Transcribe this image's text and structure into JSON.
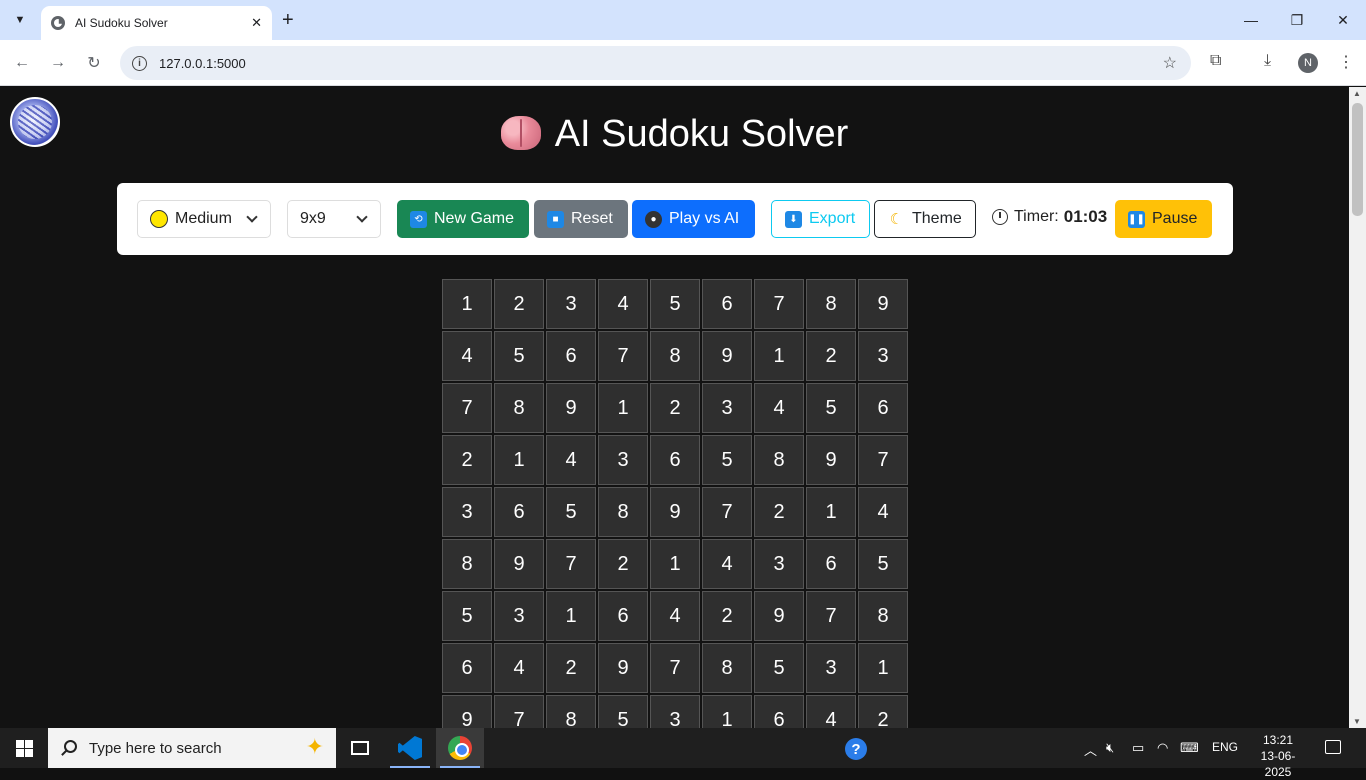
{
  "browser": {
    "tab_title": "AI Sudoku Solver",
    "url": "127.0.0.1:5000",
    "profile_initial": "N"
  },
  "page": {
    "title": "AI Sudoku Solver"
  },
  "controls": {
    "difficulty": "Medium",
    "grid_size": "9x9",
    "new_game_label": "New Game",
    "reset_label": "Reset",
    "play_ai_label": "Play vs AI",
    "export_label": "Export",
    "theme_label": "Theme",
    "timer_label": "Timer:",
    "timer_value": "01:03",
    "pause_label": "Pause"
  },
  "colors": {
    "new_game": "#198754",
    "reset": "#6c757d",
    "play_ai": "#0d6efd",
    "export": "#0dcaf0",
    "pause": "#ffc107",
    "page_bg": "#121212",
    "cell_bg": "#2f2f2f"
  },
  "board": [
    [
      1,
      2,
      3,
      4,
      5,
      6,
      7,
      8,
      9
    ],
    [
      4,
      5,
      6,
      7,
      8,
      9,
      1,
      2,
      3
    ],
    [
      7,
      8,
      9,
      1,
      2,
      3,
      4,
      5,
      6
    ],
    [
      2,
      1,
      4,
      3,
      6,
      5,
      8,
      9,
      7
    ],
    [
      3,
      6,
      5,
      8,
      9,
      7,
      2,
      1,
      4
    ],
    [
      8,
      9,
      7,
      2,
      1,
      4,
      3,
      6,
      5
    ],
    [
      5,
      3,
      1,
      6,
      4,
      2,
      9,
      7,
      8
    ],
    [
      6,
      4,
      2,
      9,
      7,
      8,
      5,
      3,
      1
    ],
    [
      9,
      7,
      8,
      5,
      3,
      1,
      6,
      4,
      2
    ]
  ],
  "taskbar": {
    "search_placeholder": "Type here to search",
    "language": "ENG",
    "time": "13:21",
    "date": "13-06-2025"
  }
}
